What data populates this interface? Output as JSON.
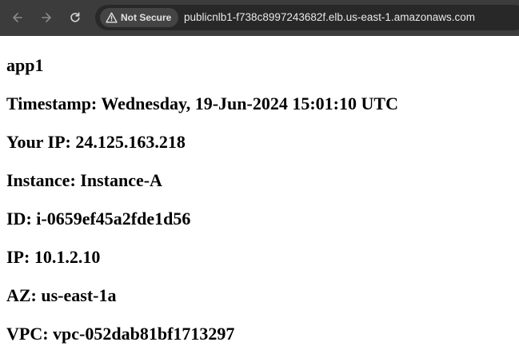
{
  "browser": {
    "back_icon": "arrow-left-icon",
    "forward_icon": "arrow-right-icon",
    "reload_icon": "reload-icon",
    "security_icon": "warning-triangle-icon",
    "security_label": "Not Secure",
    "url": "publicnlb1-f738c8997243682f.elb.us-east-1.amazonaws.com"
  },
  "page": {
    "heading": "app1",
    "lines": [
      "Timestamp: Wednesday, 19-Jun-2024 15:01:10 UTC",
      "Your IP: 24.125.163.218",
      "Instance: Instance-A",
      "ID: i-0659ef45a2fde1d56",
      "IP: 10.1.2.10",
      "AZ: us-east-1a",
      "VPC: vpc-052dab81bf1713297"
    ]
  },
  "colors": {
    "toolbar_bg": "#3c3c3c",
    "omnibox_bg": "#282828",
    "page_bg": "#ffffff",
    "text": "#000000"
  }
}
